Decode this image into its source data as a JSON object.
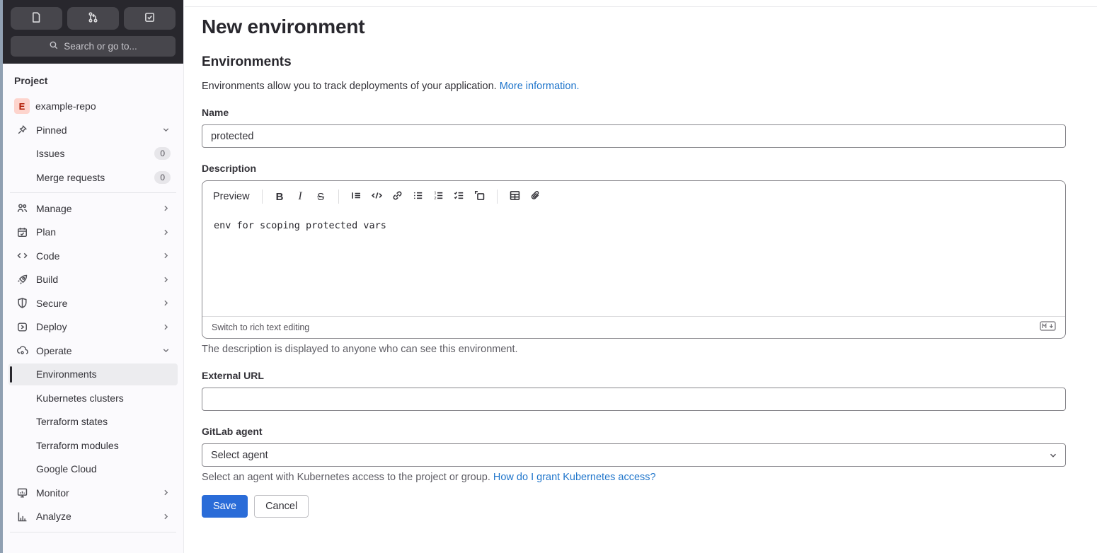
{
  "topbar": {
    "buttons": [
      "issues-icon",
      "merge-request-icon",
      "todo-check-icon"
    ],
    "search_label": "Search or go to..."
  },
  "sidebar": {
    "section_label": "Project",
    "project": {
      "initial": "E",
      "name": "example-repo"
    },
    "pinned": {
      "label": "Pinned",
      "children": [
        {
          "label": "Issues",
          "count": "0"
        },
        {
          "label": "Merge requests",
          "count": "0"
        }
      ]
    },
    "items": [
      {
        "label": "Manage",
        "icon": "users-icon"
      },
      {
        "label": "Plan",
        "icon": "calendar-icon"
      },
      {
        "label": "Code",
        "icon": "code-icon"
      },
      {
        "label": "Build",
        "icon": "rocket-icon"
      },
      {
        "label": "Secure",
        "icon": "shield-icon"
      },
      {
        "label": "Deploy",
        "icon": "deploy-icon"
      },
      {
        "label": "Operate",
        "icon": "operate-icon"
      }
    ],
    "operate_children": [
      {
        "label": "Environments",
        "active": true
      },
      {
        "label": "Kubernetes clusters"
      },
      {
        "label": "Terraform states"
      },
      {
        "label": "Terraform modules"
      },
      {
        "label": "Google Cloud"
      }
    ],
    "bottom_items": [
      {
        "label": "Monitor",
        "icon": "monitor-icon"
      },
      {
        "label": "Analyze",
        "icon": "chart-icon"
      }
    ]
  },
  "main": {
    "title": "New environment",
    "section_title": "Environments",
    "intro_text": "Environments allow you to track deployments of your application.",
    "intro_link": "More information.",
    "name_field": {
      "label": "Name",
      "value": "protected"
    },
    "description": {
      "label": "Description",
      "preview_label": "Preview",
      "toolbar_icons": [
        "bold",
        "italic",
        "strikethrough",
        "quote",
        "code",
        "link",
        "bullet-list",
        "ordered-list",
        "task-list",
        "collapsible-section",
        "table",
        "attachment"
      ],
      "content": "env for scoping protected vars",
      "switch_label": "Switch to rich text editing",
      "markdown_icon": "markdown-icon",
      "help": "The description is displayed to anyone who can see this environment."
    },
    "external_url": {
      "label": "External URL",
      "value": ""
    },
    "agent": {
      "label": "GitLab agent",
      "value": "Select agent",
      "help": "Select an agent with Kubernetes access to the project or group.",
      "help_link": "How do I grant Kubernetes access?"
    },
    "buttons": {
      "save": "Save",
      "cancel": "Cancel"
    }
  },
  "colors": {
    "accent_blue": "#2a6cd8",
    "link_blue": "#1f75cb",
    "dark_header": "#28272d",
    "sidebar_bg": "#fbfafd",
    "active_item_bg": "#ececef",
    "avatar_bg": "#fdd4cd",
    "avatar_text": "#ae1800"
  }
}
